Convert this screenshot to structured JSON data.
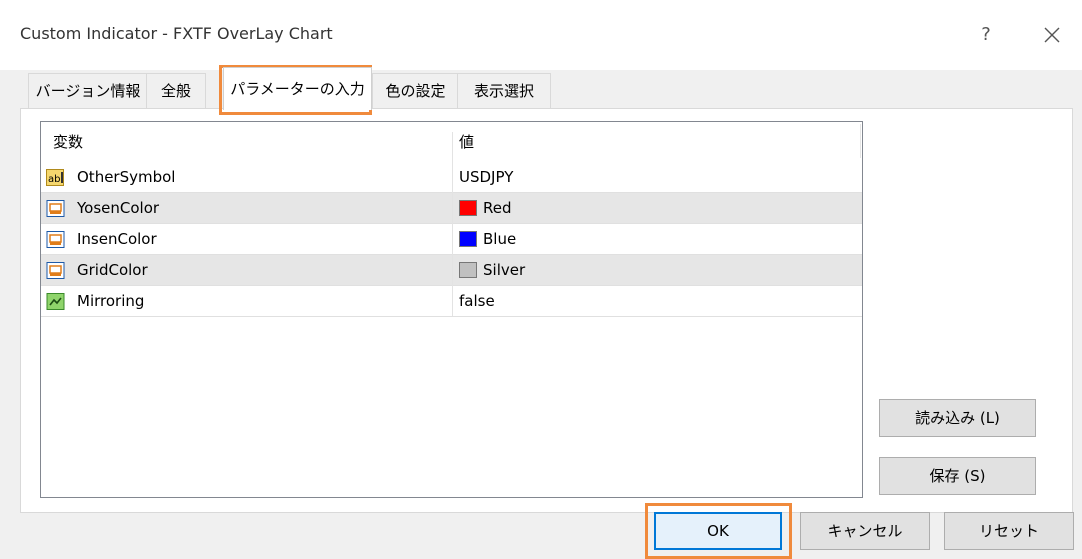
{
  "window": {
    "title": "Custom Indicator - FXTF OverLay Chart",
    "help_label": "?",
    "close_icon": "close-icon"
  },
  "tabs": [
    {
      "label": "バージョン情報",
      "active": false
    },
    {
      "label": "全般",
      "active": false
    },
    {
      "label": "パラメーターの入力",
      "active": true
    },
    {
      "label": "色の設定",
      "active": false
    },
    {
      "label": "表示選択",
      "active": false
    }
  ],
  "grid": {
    "headers": {
      "name": "変数",
      "value": "値"
    },
    "rows": [
      {
        "name": "OtherSymbol",
        "value": "USDJPY",
        "icon": "string-ab-icon",
        "swatch": null
      },
      {
        "name": "YosenColor",
        "value": "Red",
        "icon": "color-param-icon",
        "swatch": "#ff0000"
      },
      {
        "name": "InsenColor",
        "value": "Blue",
        "icon": "color-param-icon",
        "swatch": "#0000ff"
      },
      {
        "name": "GridColor",
        "value": "Silver",
        "icon": "color-param-icon",
        "swatch": "#c0c0c0"
      },
      {
        "name": "Mirroring",
        "value": "false",
        "icon": "bool-param-icon",
        "swatch": null
      }
    ]
  },
  "side_buttons": {
    "load": "読み込み (L)",
    "save": "保存 (S)"
  },
  "footer_buttons": {
    "ok": "OK",
    "cancel": "キャンセル",
    "reset": "リセット"
  },
  "colors": {
    "highlight": "#f08a3c",
    "ok_border": "#0078d7"
  }
}
